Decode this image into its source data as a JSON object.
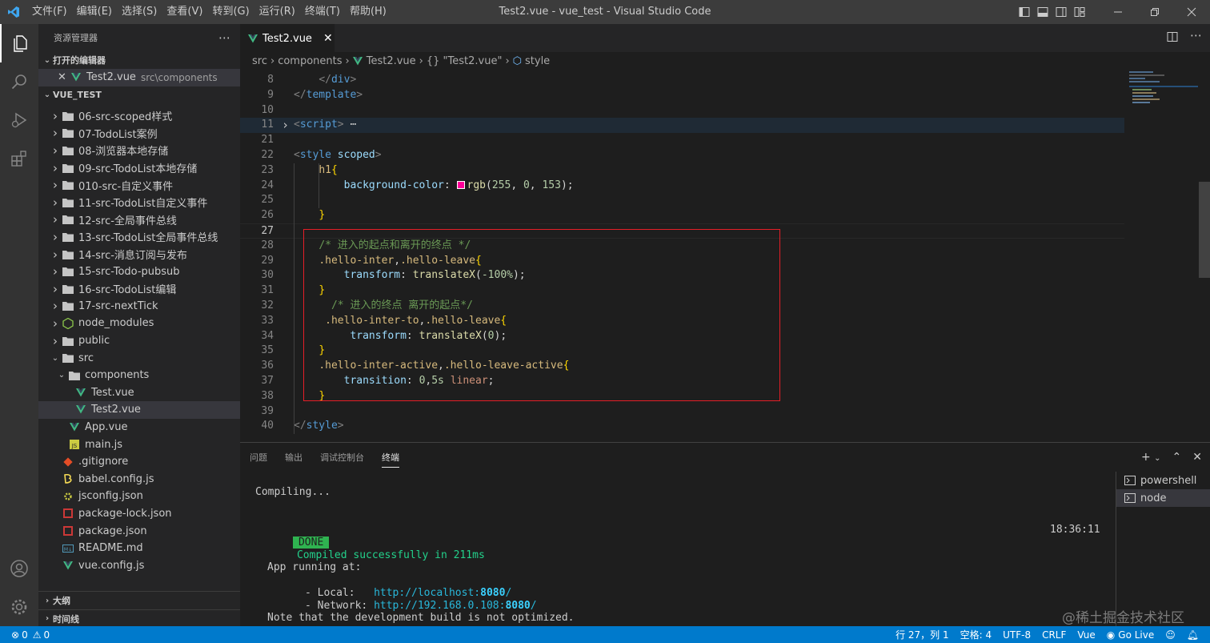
{
  "window": {
    "title": "Test2.vue - vue_test - Visual Studio Code"
  },
  "menu": [
    "文件(F)",
    "编辑(E)",
    "选择(S)",
    "查看(V)",
    "转到(G)",
    "运行(R)",
    "终端(T)",
    "帮助(H)"
  ],
  "sidebar": {
    "title": "资源管理器",
    "open_editors_label": "打开的编辑器",
    "open_editor": {
      "name": "Test2.vue",
      "path": "src\\components"
    },
    "project_label": "VUE_TEST",
    "tree": [
      {
        "label": "06-src-scoped样式",
        "type": "folder",
        "depth": 0,
        "open": false
      },
      {
        "label": "07-TodoList案例",
        "type": "folder",
        "depth": 0,
        "open": false
      },
      {
        "label": "08-浏览器本地存储",
        "type": "folder",
        "depth": 0,
        "open": false
      },
      {
        "label": "09-src-TodoList本地存储",
        "type": "folder",
        "depth": 0,
        "open": false
      },
      {
        "label": "010-src-自定义事件",
        "type": "folder",
        "depth": 0,
        "open": false
      },
      {
        "label": "11-src-TodoList自定义事件",
        "type": "folder",
        "depth": 0,
        "open": false
      },
      {
        "label": "12-src-全局事件总线",
        "type": "folder",
        "depth": 0,
        "open": false
      },
      {
        "label": "13-src-TodoList全局事件总线",
        "type": "folder",
        "depth": 0,
        "open": false
      },
      {
        "label": "14-src-消息订阅与发布",
        "type": "folder",
        "depth": 0,
        "open": false
      },
      {
        "label": "15-src-Todo-pubsub",
        "type": "folder",
        "depth": 0,
        "open": false
      },
      {
        "label": "16-src-TodoList编辑",
        "type": "folder",
        "depth": 0,
        "open": false
      },
      {
        "label": "17-src-nextTick",
        "type": "folder",
        "depth": 0,
        "open": false
      },
      {
        "label": "node_modules",
        "type": "node-folder",
        "depth": 0,
        "open": false
      },
      {
        "label": "public",
        "type": "folder",
        "depth": 0,
        "open": false
      },
      {
        "label": "src",
        "type": "folder",
        "depth": 0,
        "open": true
      },
      {
        "label": "components",
        "type": "folder",
        "depth": 1,
        "open": true
      },
      {
        "label": "Test.vue",
        "type": "vue",
        "depth": 2
      },
      {
        "label": "Test2.vue",
        "type": "vue",
        "depth": 2,
        "selected": true
      },
      {
        "label": "App.vue",
        "type": "vue",
        "depth": 1
      },
      {
        "label": "main.js",
        "type": "js",
        "depth": 1
      },
      {
        "label": ".gitignore",
        "type": "git",
        "depth": 0
      },
      {
        "label": "babel.config.js",
        "type": "babel",
        "depth": 0
      },
      {
        "label": "jsconfig.json",
        "type": "jsconfig",
        "depth": 0
      },
      {
        "label": "package-lock.json",
        "type": "npm",
        "depth": 0
      },
      {
        "label": "package.json",
        "type": "npm",
        "depth": 0
      },
      {
        "label": "README.md",
        "type": "md",
        "depth": 0
      },
      {
        "label": "vue.config.js",
        "type": "vue",
        "depth": 0
      }
    ],
    "outline_label": "大纲",
    "timeline_label": "时间线"
  },
  "editor": {
    "tab": "Test2.vue",
    "breadcrumb": [
      "src",
      "components",
      "Test2.vue",
      "{} \"Test2.vue\"",
      "style"
    ],
    "lines": [
      {
        "n": "8",
        "html": "    <span class='tag'>&lt;/</span><span class='tn'>div</span><span class='tag'>&gt;</span>"
      },
      {
        "n": "9",
        "html": "<span class='tag'>&lt;/</span><span class='tn'>template</span><span class='tag'>&gt;</span>"
      },
      {
        "n": "10",
        "html": ""
      },
      {
        "n": "11",
        "html": "<span class='tag'>&lt;</span><span class='tn'>script</span><span class='tag'>&gt;</span><span class='pl'> ⋯</span>",
        "folded": true
      },
      {
        "n": "21",
        "html": ""
      },
      {
        "n": "22",
        "html": "<span class='tag'>&lt;</span><span class='tn'>style</span> <span class='at'>scoped</span><span class='tag'>&gt;</span>"
      },
      {
        "n": "23",
        "html": "    <span class='sel'>h1</span><span class='br'>{</span>"
      },
      {
        "n": "24",
        "html": "        <span class='pr'>background-color</span><span class='pl'>: </span><span class='swatch'></span><span class='fn'>rgb</span><span class='pl'>(</span><span class='nm'>255</span><span class='pl'>, </span><span class='nm'>0</span><span class='pl'>, </span><span class='nm'>153</span><span class='pl'>);</span>"
      },
      {
        "n": "25",
        "html": ""
      },
      {
        "n": "26",
        "html": "    <span class='br'>}</span>"
      },
      {
        "n": "27",
        "html": "",
        "current": true
      },
      {
        "n": "28",
        "html": "    <span class='cm'>/* 进入的起点和离开的终点 */</span>"
      },
      {
        "n": "29",
        "html": "    <span class='sel'>.hello-inter</span><span class='pl'>,</span><span class='sel'>.hello-leave</span><span class='br'>{</span>"
      },
      {
        "n": "30",
        "html": "        <span class='pr'>transform</span><span class='pl'>: </span><span class='fn'>translateX</span><span class='pl'>(</span><span class='nm'>-100%</span><span class='pl'>);</span>"
      },
      {
        "n": "31",
        "html": "    <span class='br'>}</span>"
      },
      {
        "n": "32",
        "html": "      <span class='cm'>/* 进入的终点 离开的起点*/</span>"
      },
      {
        "n": "33",
        "html": "     <span class='sel'>.hello-inter-to</span><span class='pl'>,</span><span class='sel'>.hello-leave</span><span class='br'>{</span>"
      },
      {
        "n": "34",
        "html": "         <span class='pr'>transform</span><span class='pl'>: </span><span class='fn'>translateX</span><span class='pl'>(</span><span class='nm'>0</span><span class='pl'>);</span>"
      },
      {
        "n": "35",
        "html": "    <span class='br'>}</span>"
      },
      {
        "n": "36",
        "html": "    <span class='sel'>.hello-inter-active</span><span class='pl'>,</span><span class='sel'>.hello-leave-active</span><span class='br'>{</span>"
      },
      {
        "n": "37",
        "html": "        <span class='pr'>transition</span><span class='pl'>: </span><span class='nm'>0</span><span class='pl'>,</span><span class='nm'>5s</span> <span class='vl'>linear</span><span class='pl'>;</span>"
      },
      {
        "n": "38",
        "html": "    <span class='br'>}</span>"
      },
      {
        "n": "39",
        "html": ""
      },
      {
        "n": "40",
        "html": "<span class='tag'>&lt;/</span><span class='tn'>style</span><span class='tag'>&gt;</span>"
      }
    ]
  },
  "panel": {
    "tabs": [
      "问题",
      "输出",
      "调试控制台",
      "终端"
    ],
    "active_tab": "终端",
    "terminal": {
      "compiling": "Compiling...",
      "done_badge": "DONE",
      "done_text": "Compiled successfully in 211ms",
      "time": "18:36:11",
      "app_running": "App running at:",
      "local_label": "- Local:   ",
      "local_url_prefix": "http://localhost:",
      "local_port": "8080",
      "local_suffix": "/",
      "network_label": "- Network: ",
      "network_url_prefix": "http://192.168.0.108:",
      "network_port": "8080",
      "network_suffix": "/",
      "note": "Note that the development build is not optimized."
    },
    "terminal_list": [
      "powershell",
      "node"
    ]
  },
  "statusbar": {
    "errors": "0",
    "warnings": "0",
    "position": "行 27，列 1",
    "spaces": "空格: 4",
    "encoding": "UTF-8",
    "eol": "CRLF",
    "language": "Vue",
    "golive": "Go Live"
  },
  "watermark": "@稀土掘金技术社区",
  "colors": {
    "accent": "#007acc",
    "highlight_box": "#e51e27",
    "swatch": "#ff0099",
    "vue_green": "#41b883"
  }
}
